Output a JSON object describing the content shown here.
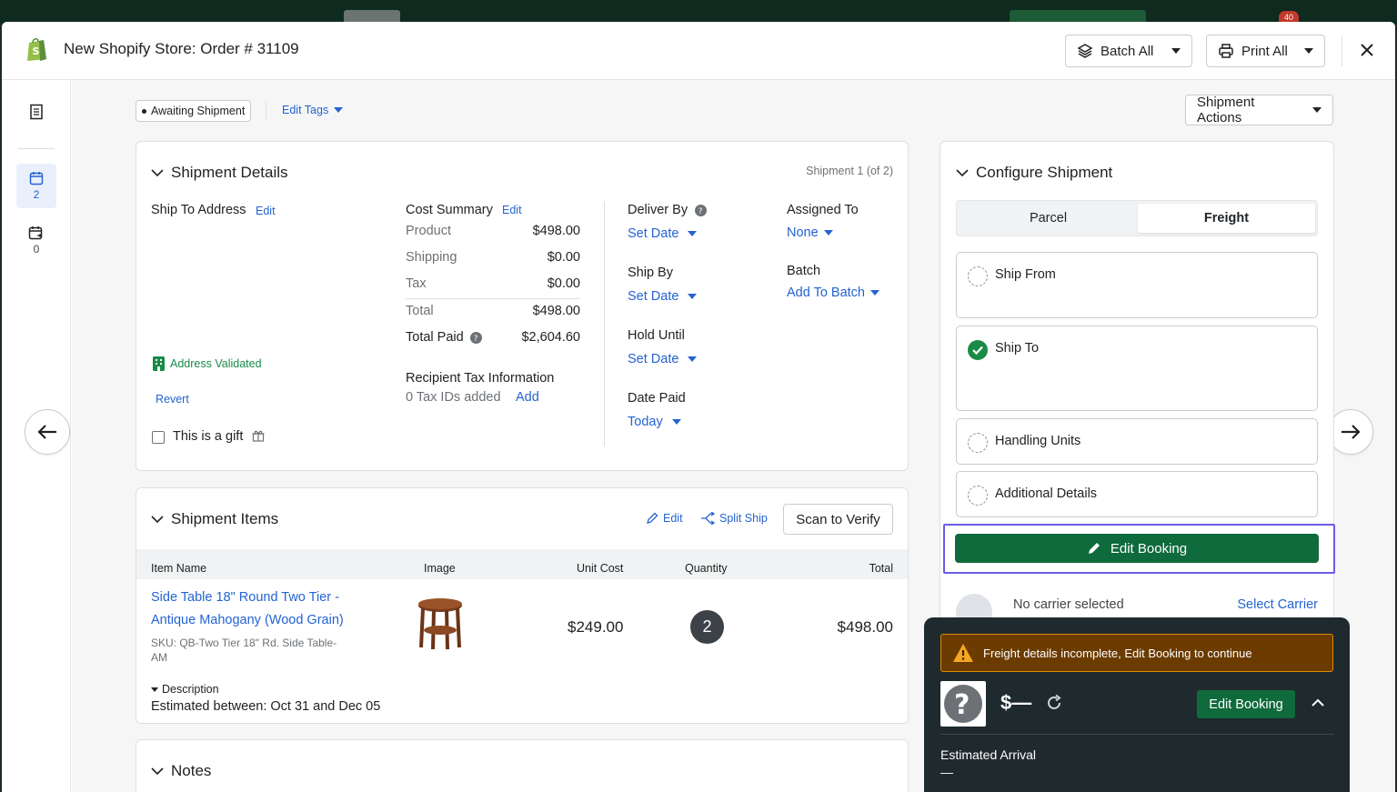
{
  "header": {
    "title": "New Shopify Store:  Order # 31109",
    "batch_all": "Batch All",
    "print_all": "Print All",
    "notification_count": "40"
  },
  "sidebar": {
    "items": [
      {
        "icon": "document-icon",
        "count": ""
      },
      {
        "icon": "calendar-icon",
        "count": "2"
      },
      {
        "icon": "calendar-return-icon",
        "count": "0"
      }
    ]
  },
  "toolbar": {
    "status_tag": "Awaiting Shipment",
    "edit_tags": "Edit Tags",
    "shipment_actions": "Shipment Actions"
  },
  "shipment_details": {
    "title": "Shipment Details",
    "shipment_counter": "Shipment 1 (of 2)",
    "ship_to_label": "Ship To Address",
    "ship_to_edit": "Edit",
    "address_validated": "Address Validated",
    "revert": "Revert",
    "gift_label": "This is a gift",
    "cost_summary": {
      "title": "Cost Summary",
      "edit": "Edit",
      "rows": [
        {
          "label": "Product",
          "value": "$498.00"
        },
        {
          "label": "Shipping",
          "value": "$0.00"
        },
        {
          "label": "Tax",
          "value": "$0.00"
        },
        {
          "label": "Total",
          "value": "$498.00"
        }
      ],
      "total_paid_label": "Total Paid",
      "total_paid_value": "$2,604.60"
    },
    "recipient_tax": {
      "title": "Recipient Tax Information",
      "count": "0 Tax IDs added",
      "add": "Add"
    },
    "deliver_by": {
      "label": "Deliver By",
      "value": "Set Date"
    },
    "ship_by": {
      "label": "Ship By",
      "value": "Set Date"
    },
    "hold_until": {
      "label": "Hold Until",
      "value": "Set Date"
    },
    "date_paid": {
      "label": "Date Paid",
      "value": "Today"
    },
    "assigned_to": {
      "label": "Assigned To",
      "value": "None"
    },
    "batch": {
      "label": "Batch",
      "value": "Add To Batch"
    }
  },
  "shipment_items": {
    "title": "Shipment Items",
    "edit": "Edit",
    "split_ship": "Split Ship",
    "scan_to_verify": "Scan to Verify",
    "columns": [
      "Item Name",
      "Image",
      "Unit Cost",
      "Quantity",
      "Total"
    ],
    "items": [
      {
        "name_line1": "Side Table 18\" Round Two Tier -",
        "name_line2": "Antique Mahogany (Wood Grain)",
        "sku_line1": "SKU: QB-Two Tier 18\" Rd. Side Table-",
        "sku_line2": "AM",
        "unit_cost": "$249.00",
        "quantity": "2",
        "total": "$498.00",
        "description_toggle": "Description",
        "estimated_label": "Estimated between:",
        "estimated_value": "Oct 31 and Dec 05"
      }
    ]
  },
  "notes": {
    "title": "Notes"
  },
  "configure": {
    "title": "Configure Shipment",
    "tabs": [
      "Parcel",
      "Freight"
    ],
    "active_tab": "Freight",
    "steps": [
      {
        "label": "Ship From",
        "done": false
      },
      {
        "label": "Ship To",
        "done": true
      },
      {
        "label": "Handling Units",
        "done": false
      },
      {
        "label": "Additional Details",
        "done": false
      }
    ],
    "edit_booking": "Edit Booking",
    "no_carrier": "No carrier selected",
    "select_carrier": "Select Carrier"
  },
  "rate_panel": {
    "warning": "Freight details incomplete, Edit Booking to continue",
    "price": "$—",
    "edit_booking": "Edit Booking",
    "estimated_arrival_label": "Estimated Arrival",
    "estimated_arrival_value": "—"
  },
  "colors": {
    "accent_blue": "#2463d1",
    "primary_green": "#0f6a3c",
    "warning_bg": "#6b3b00",
    "highlight_outline": "#6c5ce7"
  }
}
